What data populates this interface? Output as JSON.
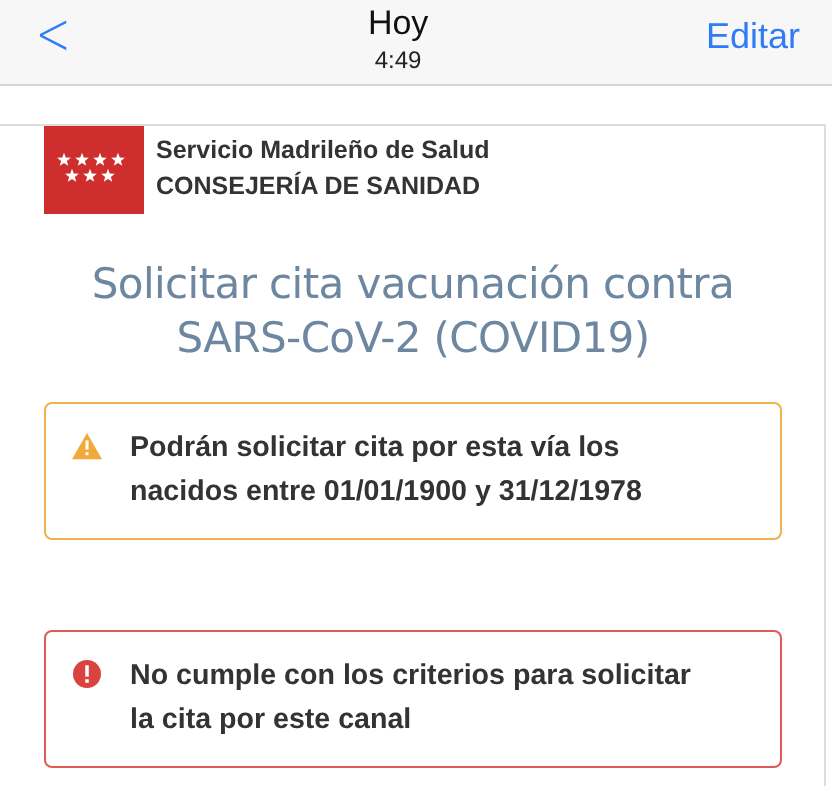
{
  "nav_bar": {
    "back_label": "<",
    "title": "Hoy",
    "subtitle": "4:49",
    "action": "Editar"
  },
  "header": {
    "organization": "Servicio Madrileño de Salud",
    "department": "CONSEJERÍA DE SANIDAD"
  },
  "title": "Solicitar cita vacunación contra SARS-CoV-2 (COVID19)",
  "alerts": [
    {
      "kind": "warning",
      "text": "Podrán solicitar cita por esta vía los nacidos entre 01/01/1900 y 31/12/1978"
    },
    {
      "kind": "error",
      "text": "No cumple con los criterios para solicitar la cita por este canal"
    }
  ]
}
